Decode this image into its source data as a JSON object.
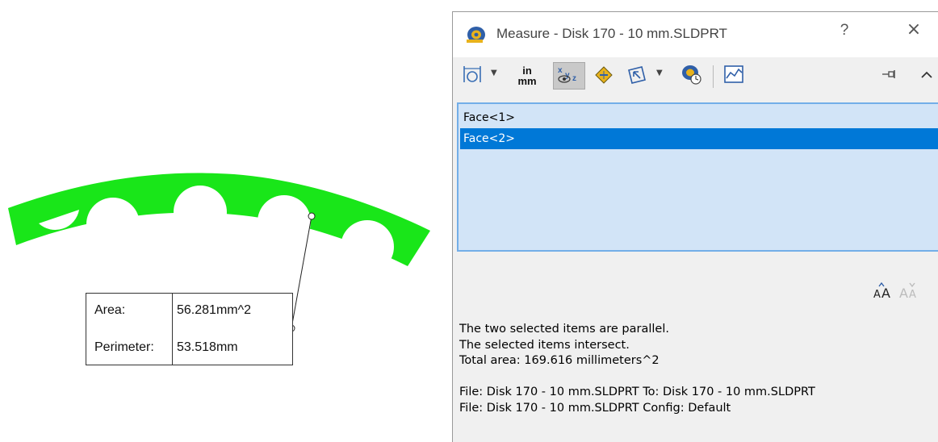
{
  "callout": {
    "area_label": "Area:",
    "area_value": "56.281mm^2",
    "perimeter_label": "Perimeter:",
    "perimeter_value": "53.518mm"
  },
  "dialog": {
    "title": "Measure - Disk 170 - 10 mm.SLDPRT",
    "help_label": "?",
    "close_label": "×",
    "toolbar": {
      "units_top": "in",
      "units_bottom": "mm",
      "items": [
        "arc-circle-measure-icon",
        "units-precision-icon",
        "show-xyz-icon",
        "point-to-point-icon",
        "projection-icon",
        "measure-history-icon",
        "create-sensor-icon",
        "pin-icon",
        "collapse-icon"
      ]
    },
    "selections": [
      {
        "label": "Face<1>",
        "selected": false
      },
      {
        "label": "Face<2>",
        "selected": true
      }
    ],
    "font_tools": [
      "increase-font-icon",
      "decrease-font-icon"
    ],
    "results": [
      "The two selected items are parallel.",
      "The selected items intersect.",
      "Total area: 169.616 millimeters^2",
      "",
      "File: Disk 170 - 10 mm.SLDPRT To: Disk 170 - 10 mm.SLDPRT",
      "File: Disk 170 - 10 mm.SLDPRT Config: Default"
    ]
  },
  "colors": {
    "part_fill": "#19e619",
    "selection_bg": "#0078d7",
    "list_bg": "#d2e4f7",
    "list_border": "#73aee8"
  }
}
